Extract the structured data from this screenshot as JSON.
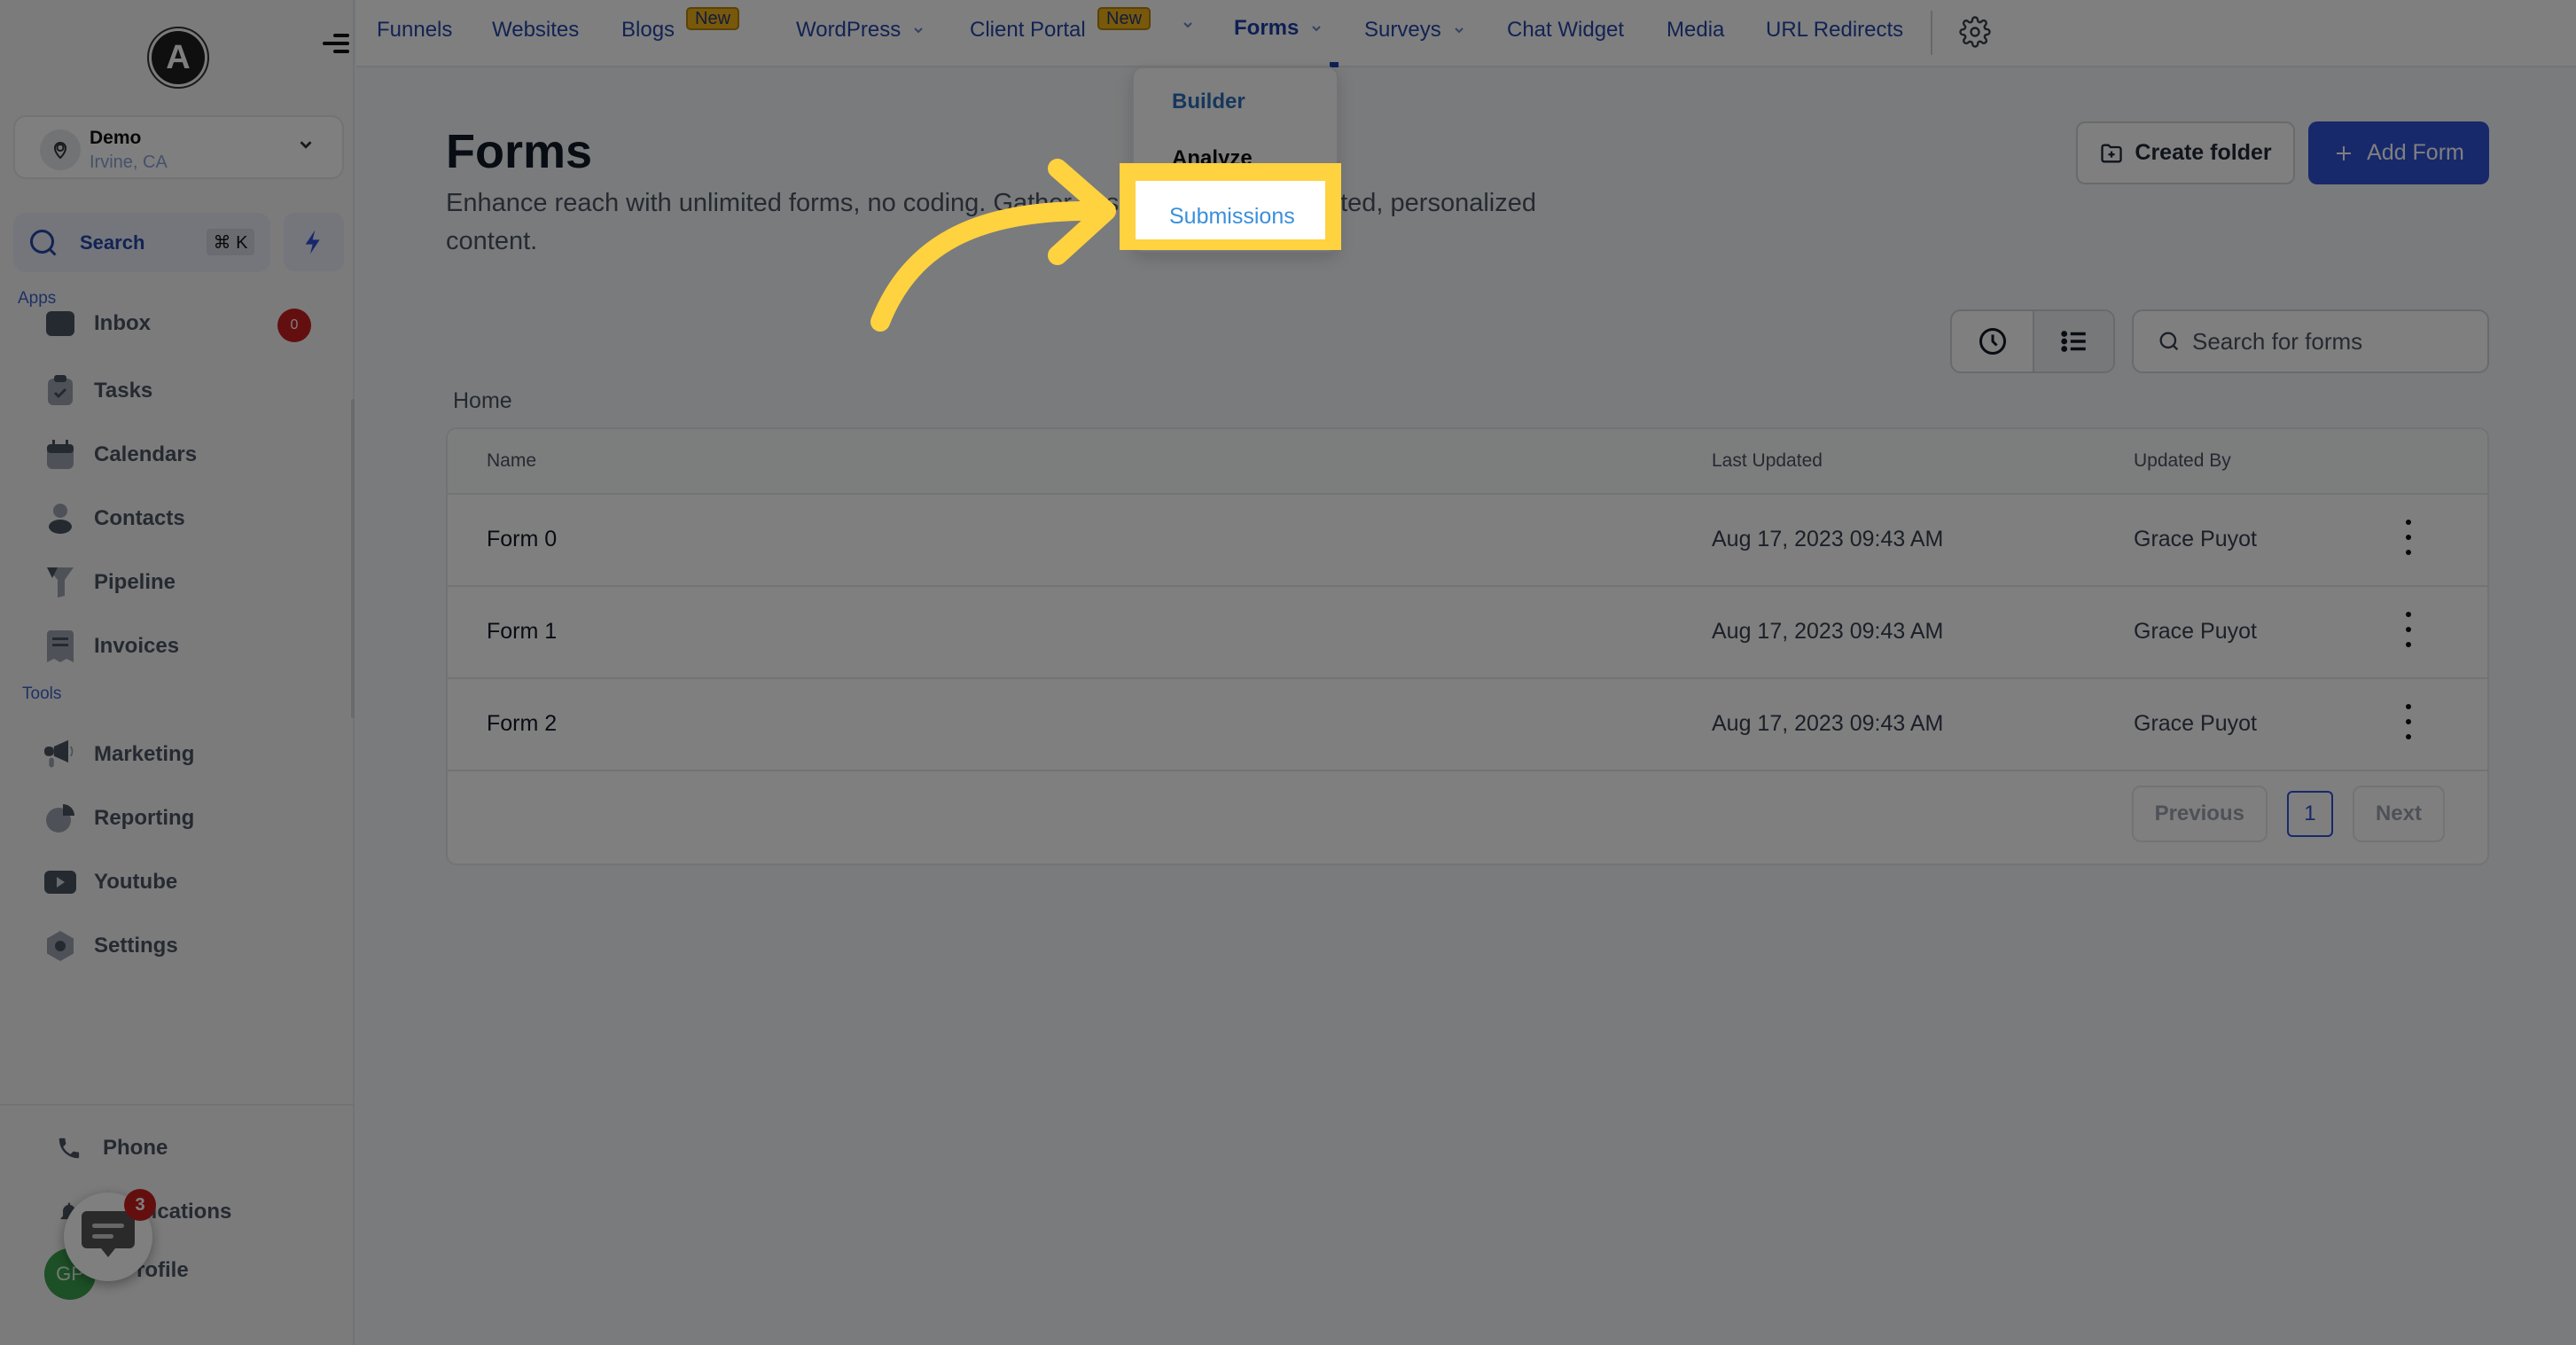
{
  "sidebar": {
    "logo_letter": "A",
    "account": {
      "name": "Demo",
      "location": "Irvine, CA"
    },
    "search": {
      "label": "Search",
      "shortcut": "⌘ K"
    },
    "sections": {
      "apps": "Apps",
      "tools": "Tools"
    },
    "apps": [
      {
        "label": "Inbox",
        "icon": "inbox-icon",
        "badge": "0"
      },
      {
        "label": "Tasks",
        "icon": "tasks-icon"
      },
      {
        "label": "Calendars",
        "icon": "calendar-icon"
      },
      {
        "label": "Contacts",
        "icon": "contacts-icon"
      },
      {
        "label": "Pipeline",
        "icon": "pipeline-icon"
      },
      {
        "label": "Invoices",
        "icon": "invoices-icon"
      }
    ],
    "tools": [
      {
        "label": "Marketing",
        "icon": "megaphone-icon"
      },
      {
        "label": "Reporting",
        "icon": "pie-chart-icon"
      },
      {
        "label": "Youtube",
        "icon": "youtube-icon"
      },
      {
        "label": "Settings",
        "icon": "settings-icon"
      }
    ],
    "bottom": [
      {
        "label": "Phone",
        "icon": "phone-icon"
      },
      {
        "label": "Notifications",
        "icon": "bell-icon"
      },
      {
        "label": "Profile",
        "avatar_initials": "GP"
      }
    ],
    "chat_widget_badge": "3"
  },
  "topnav": {
    "items": [
      {
        "label": "Funnels"
      },
      {
        "label": "Websites"
      },
      {
        "label": "Blogs",
        "badge": "New"
      },
      {
        "label": "WordPress",
        "dropdown": true
      },
      {
        "label": "Client Portal",
        "badge": "New",
        "dropdown": true
      },
      {
        "label": "Forms",
        "dropdown": true,
        "active": true
      },
      {
        "label": "Surveys",
        "dropdown": true
      },
      {
        "label": "Chat Widget"
      },
      {
        "label": "Media"
      },
      {
        "label": "URL Redirects"
      }
    ]
  },
  "forms_menu": {
    "items": [
      "Builder",
      "Analyze",
      "Submissions"
    ],
    "highlighted": "Submissions"
  },
  "page": {
    "title": "Forms",
    "subtitle": "Enhance reach with unlimited forms, no coding. Gather essential data for targeted, personalized content.",
    "create_folder": "Create folder",
    "add_form": "Add Form",
    "search_placeholder": "Search for forms",
    "breadcrumb": "Home"
  },
  "table": {
    "columns": [
      "Name",
      "Last Updated",
      "Updated By"
    ],
    "rows": [
      {
        "name": "Form 0",
        "last_updated": "Aug 17, 2023 09:43 AM",
        "updated_by": "Grace Puyot"
      },
      {
        "name": "Form 1",
        "last_updated": "Aug 17, 2023 09:43 AM",
        "updated_by": "Grace Puyot"
      },
      {
        "name": "Form 2",
        "last_updated": "Aug 17, 2023 09:43 AM",
        "updated_by": "Grace Puyot"
      }
    ],
    "pagination": {
      "previous": "Previous",
      "current": "1",
      "next": "Next"
    }
  },
  "colors": {
    "accent": "#2f52d6",
    "highlight": "#ffd23f",
    "new_badge": "#f0b216",
    "alert": "#c81e1e"
  }
}
